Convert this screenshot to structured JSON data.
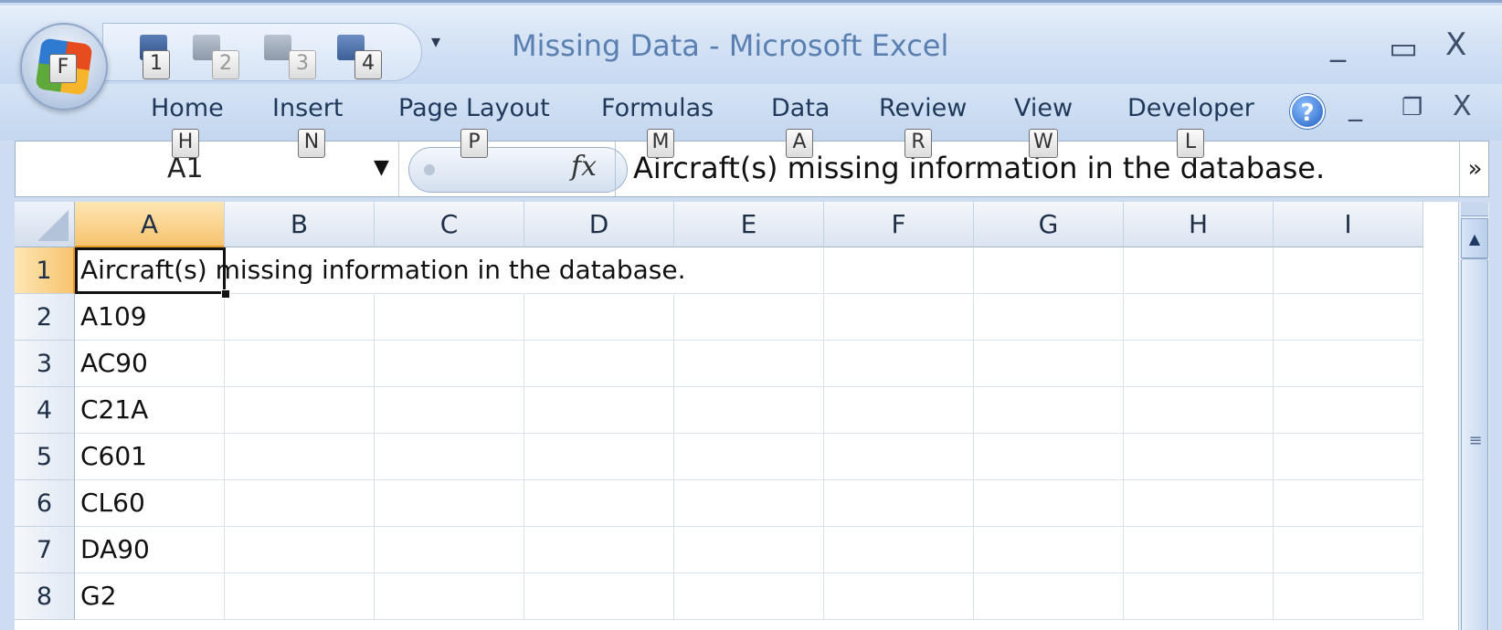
{
  "window": {
    "title": "Missing Data - Microsoft Excel",
    "minimize": "_",
    "maximize": "▭",
    "close": "X"
  },
  "office_button": {
    "keytip": "F"
  },
  "quick_access": {
    "keytips": [
      "1",
      "2",
      "3",
      "4"
    ],
    "customize": "▾"
  },
  "ribbon_tabs": [
    {
      "label": "Home",
      "keytip": "H"
    },
    {
      "label": "Insert",
      "keytip": "N"
    },
    {
      "label": "Page Layout",
      "keytip": "P"
    },
    {
      "label": "Formulas",
      "keytip": "M"
    },
    {
      "label": "Data",
      "keytip": "A"
    },
    {
      "label": "Review",
      "keytip": "R"
    },
    {
      "label": "View",
      "keytip": "W"
    },
    {
      "label": "Developer",
      "keytip": "L"
    }
  ],
  "ribbon_controls": {
    "help": "?",
    "minimize": "_",
    "restore": "❐",
    "close": "X"
  },
  "formula_bar": {
    "name_box": "A1",
    "fx": "fx",
    "formula": "Aircraft(s) missing information in the database.",
    "expand": "»"
  },
  "columns": [
    "A",
    "B",
    "C",
    "D",
    "E",
    "F",
    "G",
    "H",
    "I"
  ],
  "rows": [
    {
      "num": "1",
      "a": "Aircraft(s) missing information in the database."
    },
    {
      "num": "2",
      "a": "A109"
    },
    {
      "num": "3",
      "a": "AC90"
    },
    {
      "num": "4",
      "a": "C21A"
    },
    {
      "num": "5",
      "a": "C601"
    },
    {
      "num": "6",
      "a": "CL60"
    },
    {
      "num": "7",
      "a": "DA90"
    },
    {
      "num": "8",
      "a": "G2"
    }
  ],
  "selection": {
    "column": "A",
    "row": "1"
  }
}
